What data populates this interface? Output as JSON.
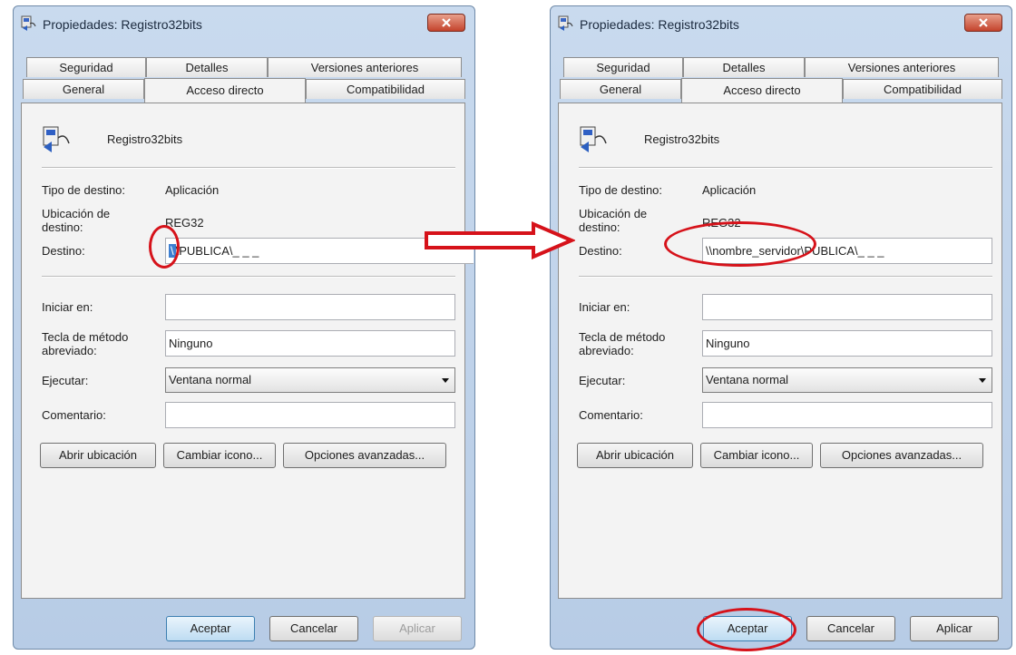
{
  "left": {
    "title": "Propiedades: Registro32bits",
    "tabs": {
      "seguridad": "Seguridad",
      "detalles": "Detalles",
      "versiones": "Versiones anteriores",
      "general": "General",
      "acceso": "Acceso directo",
      "compat": "Compatibilidad"
    },
    "name": "Registro32bits",
    "tipo_label": "Tipo de destino:",
    "tipo_value": "Aplicación",
    "ubic_label": "Ubicación de destino:",
    "ubic_value": "REG32",
    "destino_label": "Destino:",
    "destino_sel": "\\",
    "destino_value": "\\PUBLICA\\_ _ _",
    "iniciar_label": "Iniciar en:",
    "iniciar_value": "",
    "tecla_label": "Tecla de método abreviado:",
    "tecla_value": "Ninguno",
    "ejecutar_label": "Ejecutar:",
    "ejecutar_value": "Ventana normal",
    "comentario_label": "Comentario:",
    "comentario_value": "",
    "btn_abrir": "Abrir ubicación",
    "btn_cambiar": "Cambiar icono...",
    "btn_opciones": "Opciones avanzadas...",
    "btn_aceptar": "Aceptar",
    "btn_cancelar": "Cancelar",
    "btn_aplicar": "Aplicar"
  },
  "right": {
    "title": "Propiedades: Registro32bits",
    "tabs": {
      "seguridad": "Seguridad",
      "detalles": "Detalles",
      "versiones": "Versiones anteriores",
      "general": "General",
      "acceso": "Acceso directo",
      "compat": "Compatibilidad"
    },
    "name": "Registro32bits",
    "tipo_label": "Tipo de destino:",
    "tipo_value": "Aplicación",
    "ubic_label": "Ubicación de destino:",
    "ubic_value": "REG32",
    "destino_label": "Destino:",
    "destino_value": "\\\\nombre_servidor\\PUBLICA\\_ _ _",
    "iniciar_label": "Iniciar en:",
    "iniciar_value": "",
    "tecla_label": "Tecla de método abreviado:",
    "tecla_value": "Ninguno",
    "ejecutar_label": "Ejecutar:",
    "ejecutar_value": "Ventana normal",
    "comentario_label": "Comentario:",
    "comentario_value": "",
    "btn_abrir": "Abrir ubicación",
    "btn_cambiar": "Cambiar icono...",
    "btn_opciones": "Opciones avanzadas...",
    "btn_aceptar": "Aceptar",
    "btn_cancelar": "Cancelar",
    "btn_aplicar": "Aplicar"
  },
  "colors": {
    "annotation_red": "#d6121a",
    "window_frame": "#b7cce6",
    "panel": "#f3f3f3"
  }
}
